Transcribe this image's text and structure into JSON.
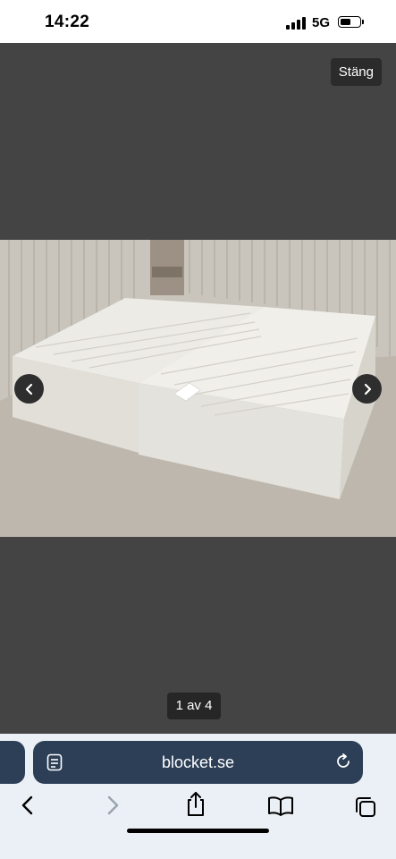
{
  "status_bar": {
    "time": "14:22",
    "network": "5G",
    "battery_level": 0.45
  },
  "viewer": {
    "close_label": "Stäng",
    "counter": "1 av 4"
  },
  "browser": {
    "url": "blocket.se"
  },
  "icons": {
    "signal": "cellular-signal-icon",
    "battery": "battery-icon",
    "prev": "chevron-left-icon",
    "next": "chevron-right-icon",
    "page": "page-menu-icon",
    "reload": "reload-icon",
    "back": "back-icon",
    "forward": "forward-icon",
    "share": "share-icon",
    "bookmarks": "book-icon",
    "tabs": "tabs-icon"
  }
}
